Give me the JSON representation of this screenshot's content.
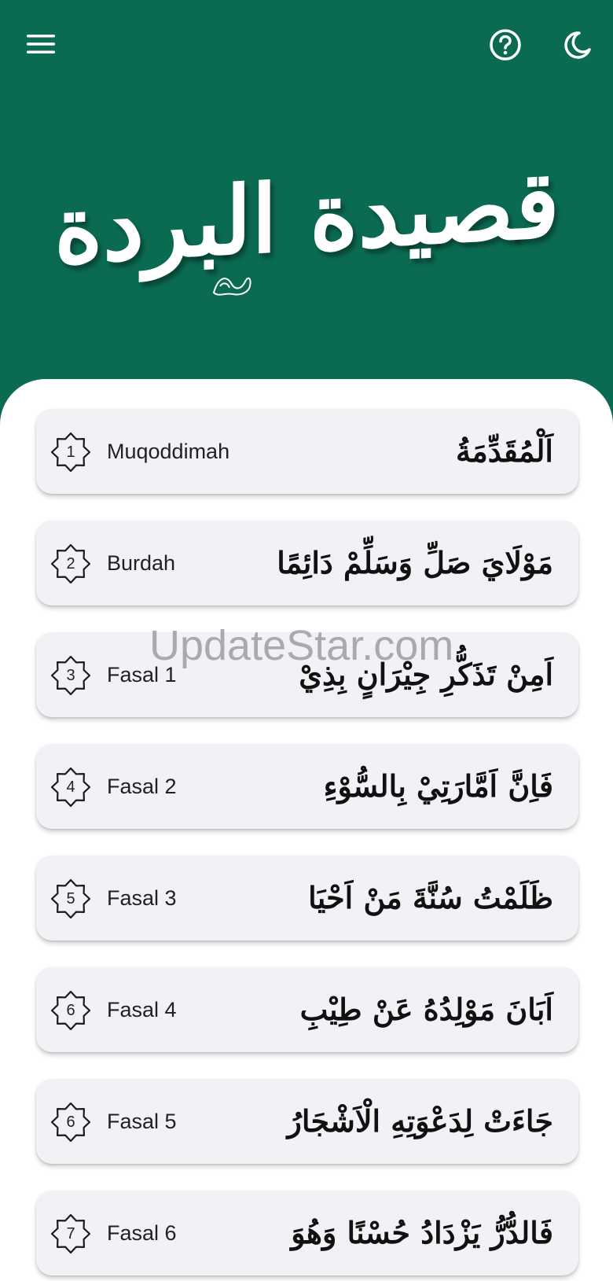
{
  "header": {
    "menu_icon": "menu-icon",
    "help_icon": "help-circle-icon",
    "theme_icon": "moon-icon",
    "logo_text": "قصيدة البردة"
  },
  "items": [
    {
      "num": "1",
      "label": "Muqoddimah",
      "arabic": "اَلْمُقَدِّمَةُ"
    },
    {
      "num": "2",
      "label": "Burdah",
      "arabic": "مَوْلَايَ صَلِّ وَسَلِّمْ دَائِمًا"
    },
    {
      "num": "3",
      "label": "Fasal 1",
      "arabic": "اَمِنْ تَذَكُّرِ جِيْرَانٍ بِذِيْ"
    },
    {
      "num": "4",
      "label": "Fasal 2",
      "arabic": "فَاِنَّ اَمَّارَتِيْ بِالسُّوْءِ"
    },
    {
      "num": "5",
      "label": "Fasal 3",
      "arabic": "ظَلَمْتُ سُنَّةَ مَنْ اَحْيَا"
    },
    {
      "num": "6",
      "label": "Fasal 4",
      "arabic": "اَبَانَ مَوْلِدُهُ عَنْ طِيْبِ"
    },
    {
      "num": "6",
      "label": "Fasal 5",
      "arabic": "جَاءَتْ لِدَعْوَتِهِ الْاَشْجَارُ"
    },
    {
      "num": "7",
      "label": "Fasal 6",
      "arabic": "فَالدُّرُّ يَزْدَادُ حُسْنًا وَهُوَ"
    }
  ],
  "watermark": "UpdateStar.com",
  "colors": {
    "primary": "#0b6b52",
    "card": "#f3f1f5",
    "surface": "#ffffff"
  }
}
